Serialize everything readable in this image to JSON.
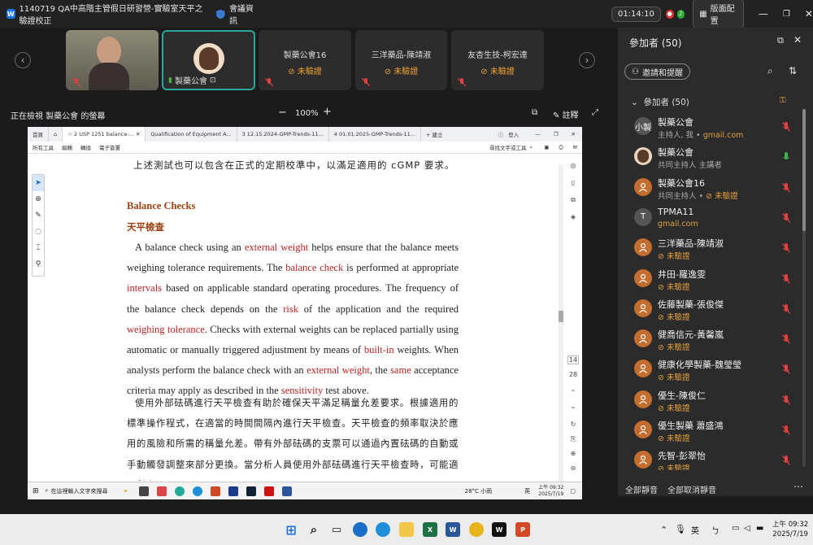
{
  "window": {
    "title": "1140719 QA中高階主管假日研習營-實驗室天平之驗證校正",
    "meeting_info": "會議資訊",
    "time": "01:14:10",
    "layout_label": "版面配置"
  },
  "strip": {
    "tiles": [
      {
        "name": "",
        "status": ""
      },
      {
        "name": "製藥公會",
        "status": ""
      },
      {
        "name": "製藥公會16",
        "status": "未驗證"
      },
      {
        "name": "三洋藥品-陳靖淑",
        "status": "未驗證"
      },
      {
        "name": "友杏生技-柯宏達",
        "status": "未驗證"
      }
    ]
  },
  "share_header": {
    "viewing": "正在檢視 製藥公會 的螢幕",
    "zoom": "100%",
    "annotate": "註釋"
  },
  "shared_window": {
    "tabs": [
      "首頁",
      "2 USP 1251 balance-...",
      "Qualification of Equipment A...",
      "3 12.15.2024-GMP-Trends-11...",
      "4 01.01.2025-GMP-Trends-11..."
    ],
    "new_tab": "+ 建立",
    "login": "登入",
    "tools": [
      "所有工具",
      "編輯",
      "轉換",
      "電子簽署"
    ],
    "search_tools": "尋找文字或工具",
    "doc": {
      "line_top": "上述測試也可以包含在正式的定期校準中，以滿足適用的 cGMP 要求。",
      "heading_en": "Balance Checks",
      "heading_zh": "天平檢查",
      "para_en": [
        {
          "t": "A balance check using an ",
          "r": false
        },
        {
          "t": "external weight",
          "r": true
        },
        {
          "t": " helps ensure that the balance meets weighing tolerance requirements. The ",
          "r": false
        },
        {
          "t": "balance check",
          "r": true
        },
        {
          "t": " is performed at appropriate ",
          "r": false
        },
        {
          "t": "intervals",
          "r": true
        },
        {
          "t": " based on applicable standard operating procedures. The frequency of the balance check depends on the ",
          "r": false
        },
        {
          "t": "risk",
          "r": true
        },
        {
          "t": " of the application and the required ",
          "r": false
        },
        {
          "t": "weighing tolerance",
          "r": true
        },
        {
          "t": ". Checks with external weights can be replaced partially using automatic or manually triggered adjustment by means of ",
          "r": false
        },
        {
          "t": "built-in",
          "r": true
        },
        {
          "t": " weights. When analysts perform the balance check with an ",
          "r": false
        },
        {
          "t": "external weight",
          "r": true
        },
        {
          "t": ", the ",
          "r": false
        },
        {
          "t": "same",
          "r": true
        },
        {
          "t": " acceptance criteria may apply as described in the ",
          "r": false
        },
        {
          "t": "sensitivity",
          "r": true
        },
        {
          "t": " test above.",
          "r": false
        }
      ],
      "para_zh": "使用外部砝碼進行天平檢查有助於確保天平滿足稱量允差要求。根據適用的標準操作程式，在適當的時間間隔內進行天平檢查。天平檢查的頻率取決於應用的風險和所需的稱量允差。帶有外部砝碼的支票可以通過內置砝碼的自動或手動觸發調整來部分更換。當分析人員使用外部砝碼進行天平檢查時，可能適用與上"
    },
    "page_num": "14",
    "page_total": "28",
    "taskbar_search": "在這裡輸入文字來搜尋",
    "weather": "28°C 小雨",
    "ime": "英",
    "tb_time": "上午 09:32",
    "tb_date": "2025/7/19"
  },
  "panel": {
    "title": "參加者 (50)",
    "invite": "邀請和提醒",
    "section": "參加者 (50)",
    "participants": [
      {
        "avatar": "小製",
        "name": "製藥公會",
        "sub": "主持人, 我 • ",
        "email": "gmail.com",
        "unv": "",
        "color": "#555555",
        "mic": "#e04040"
      },
      {
        "avatar": "",
        "name": "製藥公會",
        "sub": "共同主持人 主講者",
        "email": "",
        "unv": "",
        "color": "#e8d5c0",
        "mic": "#3cb44b"
      },
      {
        "avatar": "",
        "name": "製藥公會16",
        "sub": "共同主持人 • ",
        "email": "",
        "unv": "未驗證",
        "color": "#c36d2e",
        "mic": "#e04040"
      },
      {
        "avatar": "T",
        "name": "TPMA11",
        "sub": "",
        "email": "gmail.com",
        "unv": "",
        "color": "#555555",
        "mic": "#e04040"
      },
      {
        "avatar": "",
        "name": "三洋藥品-陳靖淑",
        "sub": "",
        "email": "",
        "unv": "未驗證",
        "color": "#c36d2e",
        "mic": "#e04040"
      },
      {
        "avatar": "",
        "name": "井田-羅逸雯",
        "sub": "",
        "email": "",
        "unv": "未驗證",
        "color": "#c36d2e",
        "mic": "#e04040"
      },
      {
        "avatar": "",
        "name": "佐藤製藥-張俊傑",
        "sub": "",
        "email": "",
        "unv": "未驗證",
        "color": "#c36d2e",
        "mic": "#e04040"
      },
      {
        "avatar": "",
        "name": "健喬信元-黃馨嵐",
        "sub": "",
        "email": "",
        "unv": "未驗證",
        "color": "#c36d2e",
        "mic": "#e04040"
      },
      {
        "avatar": "",
        "name": "健康化學製藥-魏瑩瑩",
        "sub": "",
        "email": "",
        "unv": "未驗證",
        "color": "#c36d2e",
        "mic": "#e04040"
      },
      {
        "avatar": "",
        "name": "優生-陳俊仁",
        "sub": "",
        "email": "",
        "unv": "未驗證",
        "color": "#c36d2e",
        "mic": "#e04040"
      },
      {
        "avatar": "",
        "name": "優生製藥 蕭盛鴻",
        "sub": "",
        "email": "",
        "unv": "未驗證",
        "color": "#c36d2e",
        "mic": "#e04040"
      },
      {
        "avatar": "",
        "name": "先智-彭翠怡",
        "sub": "",
        "email": "",
        "unv": "未驗證",
        "color": "#c36d2e",
        "mic": "#e04040"
      }
    ],
    "mute_all": "全部靜音",
    "unmute_all": "全部取消靜音"
  },
  "taskbar": {
    "ime": "英",
    "time": "上午 09:32",
    "date": "2025/7/19"
  }
}
